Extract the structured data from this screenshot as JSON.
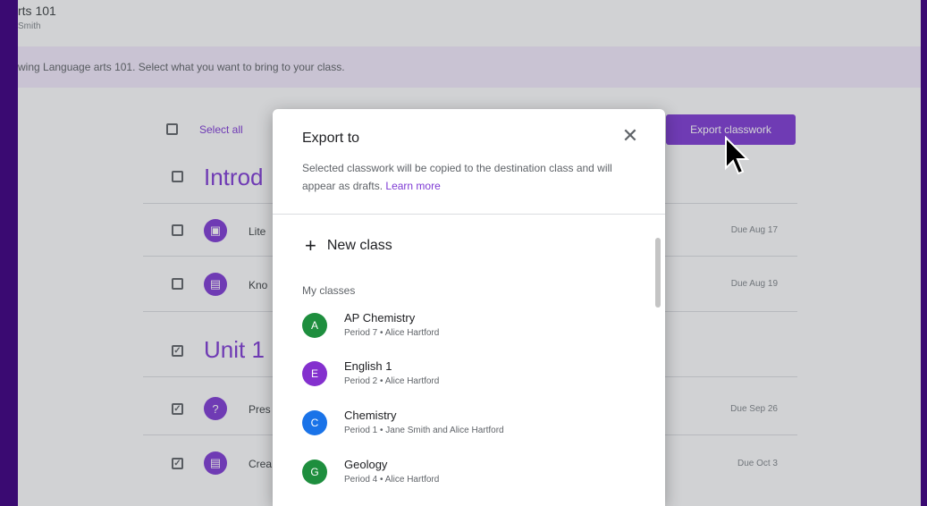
{
  "background": {
    "course_title": "rts 101",
    "course_subtitle": "Smith",
    "banner_text": "wing Language arts 101. Select what you want to bring to your class.",
    "select_all_label": "Select all",
    "export_button_label": "Export classwork",
    "topics": [
      {
        "label": "Introd",
        "checked": false
      },
      {
        "label": "Unit 1",
        "checked": true
      }
    ],
    "rows": [
      {
        "label": "Lite",
        "icon": "book-icon",
        "due": "Due Aug 17",
        "checked": false
      },
      {
        "label": "Kno",
        "icon": "assignment-icon",
        "due": "Due Aug 19",
        "checked": false
      },
      {
        "label": "Pres",
        "icon": "question-icon",
        "due": "Due Sep 26",
        "checked": true
      },
      {
        "label": "Crea",
        "icon": "assignment-icon",
        "due": "Due Oct 3",
        "checked": true
      }
    ]
  },
  "modal": {
    "title": "Export to",
    "close_icon": "close-icon",
    "description": "Selected classwork will be copied to the destination class and will appear as drafts.",
    "learn_more": "Learn more",
    "new_class_label": "New class",
    "my_classes_label": "My classes",
    "classes": [
      {
        "initial": "A",
        "name": "AP Chemistry",
        "detail": "Period 7 • Alice Hartford",
        "color": "#1e8e3e"
      },
      {
        "initial": "E",
        "name": "English 1",
        "detail": "Period 2 • Alice Hartford",
        "color": "#8430ce"
      },
      {
        "initial": "C",
        "name": "Chemistry",
        "detail": "Period 1 • Jane Smith and Alice Hartford",
        "color": "#1a73e8"
      },
      {
        "initial": "G",
        "name": "Geology",
        "detail": "Period 4 • Alice Hartford",
        "color": "#1e8e3e"
      }
    ]
  },
  "colors": {
    "accent": "#7e3ad4",
    "frame": "#3a0a72"
  }
}
